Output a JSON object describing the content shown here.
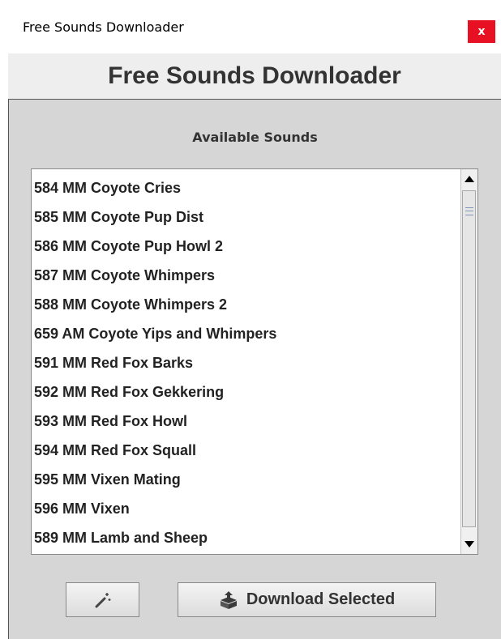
{
  "window": {
    "title": "Free Sounds Downloader",
    "close_label": "x"
  },
  "header": {
    "title": "Free Sounds Downloader"
  },
  "available_sounds": {
    "label": "Available Sounds",
    "items": [
      "584 MM Coyote Cries",
      "585 MM Coyote Pup Dist",
      "586 MM Coyote Pup Howl 2",
      "587 MM Coyote Whimpers",
      "588 MM Coyote Whimpers 2",
      "659 AM Coyote Yips and Whimpers",
      "591 MM Red Fox Barks",
      "592 MM Red Fox Gekkering",
      "593 MM Red Fox Howl",
      "594 MM Red Fox Squall",
      "595 MM Vixen Mating",
      "596 MM Vixen",
      "589 MM Lamb and Sheep"
    ]
  },
  "buttons": {
    "wand_icon": "magic-wand-icon",
    "download_icon": "download-box-icon",
    "download_label": "Download Selected"
  }
}
